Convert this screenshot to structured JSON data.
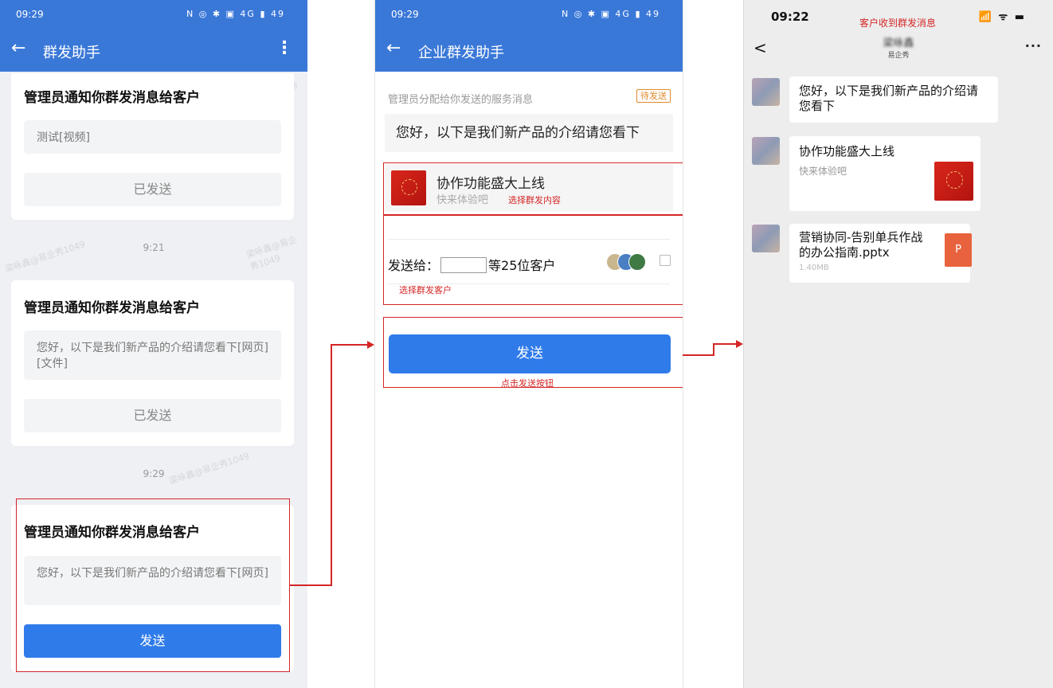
{
  "panel1": {
    "status_time": "09:29",
    "status_icons": "N ◎ ✱ ▣ 4G ▮ 49",
    "back_glyph": "←",
    "title": "群发助手",
    "more_glyph": "⋮",
    "watermark": "梁咏鑫@易企秀1049",
    "card1": {
      "title": "管理员通知你群发消息给客户",
      "message": "测试[视频]",
      "button": "已发送"
    },
    "time1": "9:21",
    "card2": {
      "title": "管理员通知你群发消息给客户",
      "message": "您好，以下是我们新产品的介绍请您看下[网页][文件]",
      "button": "已发送"
    },
    "time2": "9:29",
    "card3": {
      "title": "管理员通知你群发消息给客户",
      "message": "您好，以下是我们新产品的介绍请您看下[网页]",
      "button": "发送"
    }
  },
  "panel2": {
    "status_time": "09:29",
    "status_icons": "N ◎ ✱ ▣ 4G ▮ 49",
    "back_glyph": "←",
    "title": "企业群发助手",
    "hint": "管理员分配给你发送的服务消息",
    "badge": "待发送",
    "message": "您好，以下是我们新产品的介绍请您看下",
    "link_title": "协作功能盛大上线",
    "link_subtitle": "快来体验吧",
    "note_content": "选择群发内容",
    "send_to_label": "发送给：",
    "send_to_suffix": "等25位客户",
    "note_customers": "选择群发客户",
    "send_button": "发送",
    "note_send": "点击发送按钮"
  },
  "panel3": {
    "status_time": "09:22",
    "status_icons": "📶 ᯤ ▬",
    "note_received": "客户收到群发消息",
    "back_glyph": "<",
    "chat_name": "梁咏鑫",
    "chat_sub": "易企秀",
    "more_glyph": "···",
    "msg1": "您好，以下是我们新产品的介绍请您看下",
    "link_title": "协作功能盛大上线",
    "link_subtitle": "快来体验吧",
    "file_name": "营销协同-告别单兵作战的办公指南.pptx",
    "file_size": "1.40MB",
    "file_icon_letter": "P"
  }
}
